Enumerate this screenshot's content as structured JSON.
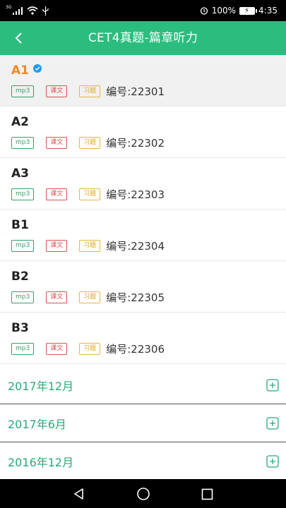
{
  "status_bar": {
    "network": "3G",
    "battery": "100%",
    "time": "4:35"
  },
  "app_bar": {
    "title": "CET4真题-篇章听力",
    "back_icon": "chevron-left-icon"
  },
  "colors": {
    "primary": "#2bbd7e",
    "selected_title": "#f08a24",
    "mp3_tag": "#36a06a",
    "text_tag": "#d9534f",
    "exercise_tag": "#d9a51b",
    "verified": "#1e9bf0"
  },
  "tag_labels": {
    "mp3": "mp3",
    "text": "课文",
    "exercise": "习题"
  },
  "items": [
    {
      "title": "A1",
      "code": "编号:22301",
      "selected": true
    },
    {
      "title": "A2",
      "code": "编号:22302",
      "selected": false
    },
    {
      "title": "A3",
      "code": "编号:22303",
      "selected": false
    },
    {
      "title": "B1",
      "code": "编号:22304",
      "selected": false
    },
    {
      "title": "B2",
      "code": "编号:22305",
      "selected": false
    },
    {
      "title": "B3",
      "code": "编号:22306",
      "selected": false
    }
  ],
  "sections": [
    {
      "label": "2017年12月"
    },
    {
      "label": "2017年6月"
    },
    {
      "label": "2016年12月"
    }
  ]
}
